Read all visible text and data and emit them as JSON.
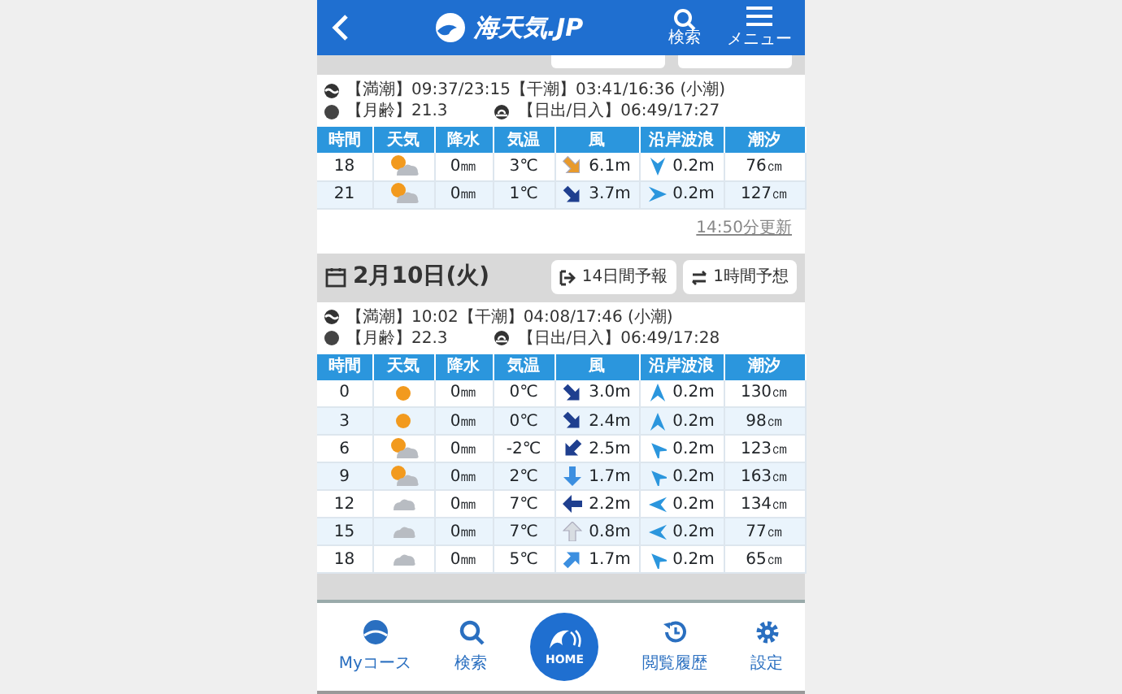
{
  "header": {
    "logo": "海天気.JP",
    "search_label": "検索",
    "menu_label": "メニュー"
  },
  "days": [
    {
      "cut_header": true,
      "tide": "【満潮】09:37/23:15【干潮】03:41/16:36  (小潮)",
      "moon": "【月齢】21.3",
      "sun": "【日出/日入】06:49/17:27",
      "columns": [
        "時間",
        "天気",
        "降水",
        "気温",
        "風",
        "沿岸波浪",
        "潮汐"
      ],
      "rows": [
        {
          "time": "18",
          "weather": {
            "kind": "partly_cloudy"
          },
          "rain": "0㎜",
          "temp": "3℃",
          "wind_arrow": {
            "kind": "down_right",
            "color": "#e89a2c"
          },
          "wind": "6.1m",
          "wave_arrow": {
            "kind": "down"
          },
          "wave": "0.2m",
          "tide": "76㎝"
        },
        {
          "time": "21",
          "weather": {
            "kind": "partly_cloudy"
          },
          "rain": "0㎜",
          "temp": "1℃",
          "wind_arrow": {
            "kind": "down_right",
            "color": "#1f3f8f"
          },
          "wind": "3.7m",
          "wave_arrow": {
            "kind": "right"
          },
          "wave": "0.2m",
          "tide": "127㎝"
        }
      ],
      "updated": "14:50分更新"
    },
    {
      "cut_header": false,
      "date": "2月10日(火)",
      "buttons": [
        "14日間予報",
        "1時間予想"
      ],
      "tide": "【満潮】10:02【干潮】04:08/17:46  (小潮)",
      "moon": "【月齢】22.3",
      "sun": "【日出/日入】06:49/17:28",
      "columns": [
        "時間",
        "天気",
        "降水",
        "気温",
        "風",
        "沿岸波浪",
        "潮汐"
      ],
      "rows": [
        {
          "time": "0",
          "weather": {
            "kind": "sunny"
          },
          "rain": "0㎜",
          "temp": "0℃",
          "wind_arrow": {
            "kind": "down_right",
            "color": "#1f3f8f"
          },
          "wind": "3.0m",
          "wave_arrow": {
            "kind": "up"
          },
          "wave": "0.2m",
          "tide": "130㎝"
        },
        {
          "time": "3",
          "weather": {
            "kind": "sunny"
          },
          "rain": "0㎜",
          "temp": "0℃",
          "wind_arrow": {
            "kind": "down_right",
            "color": "#1f3f8f"
          },
          "wind": "2.4m",
          "wave_arrow": {
            "kind": "up"
          },
          "wave": "0.2m",
          "tide": "98㎝"
        },
        {
          "time": "6",
          "weather": {
            "kind": "partly_cloudy"
          },
          "rain": "0㎜",
          "temp": "-2℃",
          "wind_arrow": {
            "kind": "down_left",
            "color": "#1f3f8f"
          },
          "wind": "2.5m",
          "wave_arrow": {
            "kind": "up_left"
          },
          "wave": "0.2m",
          "tide": "123㎝"
        },
        {
          "time": "9",
          "weather": {
            "kind": "partly_cloudy"
          },
          "rain": "0㎜",
          "temp": "2℃",
          "wind_arrow": {
            "kind": "down",
            "color": "#3c8fe0"
          },
          "wind": "1.7m",
          "wave_arrow": {
            "kind": "up_left"
          },
          "wave": "0.2m",
          "tide": "163㎝"
        },
        {
          "time": "12",
          "weather": {
            "kind": "cloudy"
          },
          "rain": "0㎜",
          "temp": "7℃",
          "wind_arrow": {
            "kind": "left",
            "color": "#1f3f8f"
          },
          "wind": "2.2m",
          "wave_arrow": {
            "kind": "left"
          },
          "wave": "0.2m",
          "tide": "134㎝"
        },
        {
          "time": "15",
          "weather": {
            "kind": "cloudy"
          },
          "rain": "0㎜",
          "temp": "7℃",
          "wind_arrow": {
            "kind": "up",
            "color": "#d8dde2"
          },
          "wind": "0.8m",
          "wave_arrow": {
            "kind": "left"
          },
          "wave": "0.2m",
          "tide": "77㎝"
        },
        {
          "time": "18",
          "weather": {
            "kind": "cloudy"
          },
          "rain": "0㎜",
          "temp": "5℃",
          "wind_arrow": {
            "kind": "up_right",
            "color": "#3c8fe0"
          },
          "wind": "1.7m",
          "wave_arrow": {
            "kind": "up_left"
          },
          "wave": "0.2m",
          "tide": "65㎝"
        }
      ]
    }
  ],
  "nav": [
    {
      "kind": "course",
      "label": "Myコース"
    },
    {
      "kind": "search",
      "label": "検索"
    },
    {
      "kind": "home",
      "label": "HOME"
    },
    {
      "kind": "history",
      "label": "閲覧履歴"
    },
    {
      "kind": "settings",
      "label": "設定"
    }
  ]
}
